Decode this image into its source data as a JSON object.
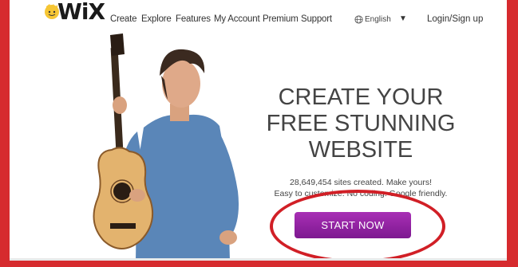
{
  "brand": {
    "name": "WiX"
  },
  "nav": {
    "items": [
      {
        "label": "Create"
      },
      {
        "label": "Explore"
      },
      {
        "label": "Features"
      },
      {
        "label": "My Account"
      },
      {
        "label": "Premium"
      },
      {
        "label": "Support"
      }
    ],
    "language": "English",
    "language_caret": "▼",
    "login": "Login/Sign up"
  },
  "hero": {
    "headline": [
      "CREATE YOUR",
      "FREE STUNNING",
      "WEBSITE"
    ],
    "subtext": [
      "28,649,454 sites created. Make yours!",
      "Easy to customize. No coding. Google friendly."
    ],
    "cta_label": "START NOW"
  },
  "colors": {
    "frame_border": "#d62b2e",
    "cta": "#9b27a8",
    "annotation": "#d11f26"
  },
  "icons": [
    "wix-logo-face-icon",
    "globe-icon",
    "chevron-down-icon"
  ]
}
